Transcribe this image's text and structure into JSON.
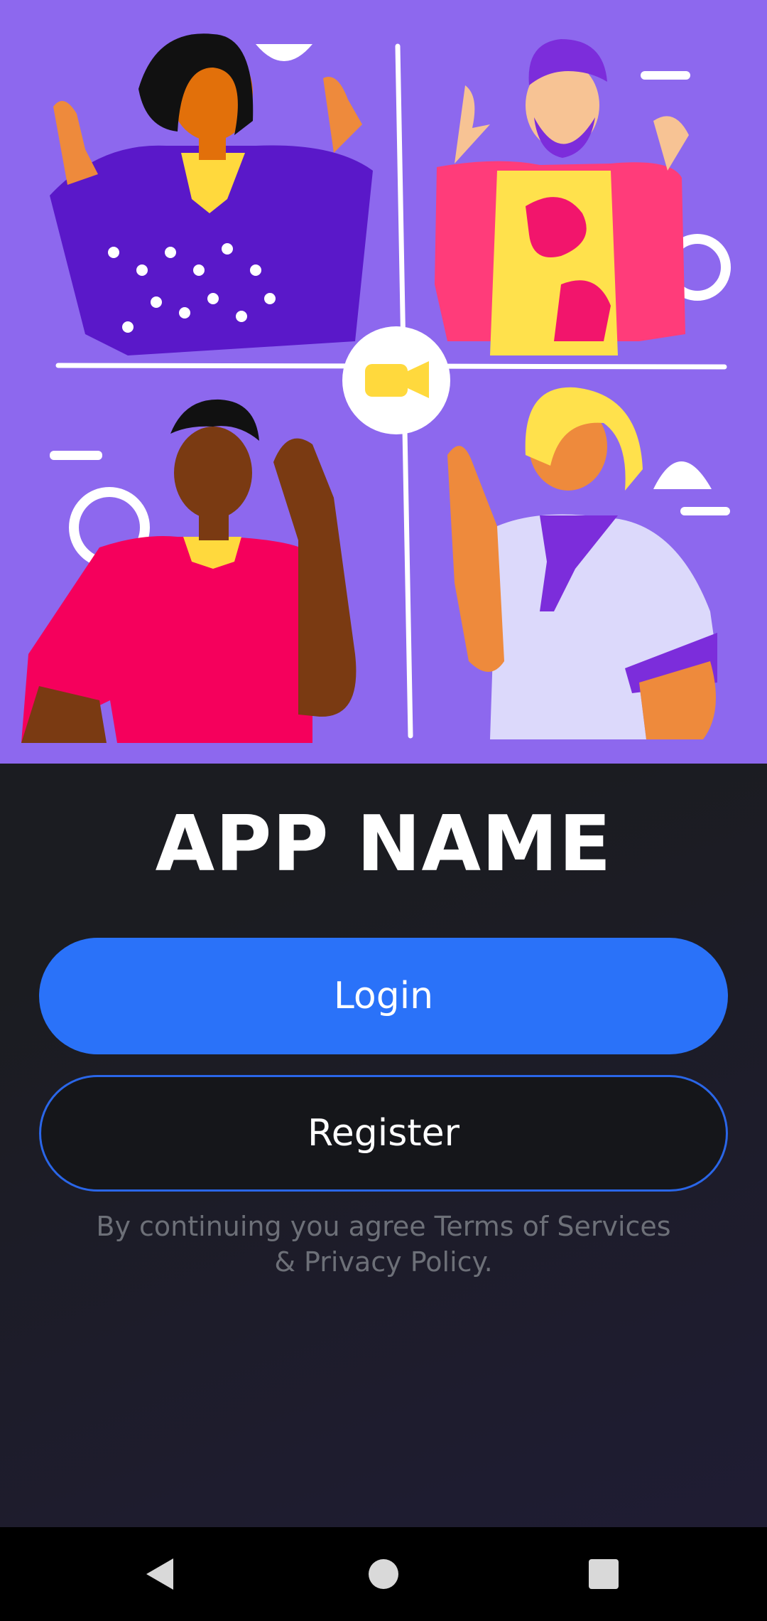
{
  "app": {
    "title": "APP NAME"
  },
  "buttons": {
    "login_label": "Login",
    "register_label": "Register"
  },
  "terms": {
    "text": "By continuing you agree Terms of Services & Privacy Policy."
  },
  "nav": {
    "back_icon": "back-triangle",
    "home_icon": "home-circle",
    "recent_icon": "recents-square"
  },
  "colors": {
    "hero_background": "#8d68ee",
    "primary": "#2a72f9",
    "background": "#1b1c21",
    "terms_text": "#6d7078"
  }
}
